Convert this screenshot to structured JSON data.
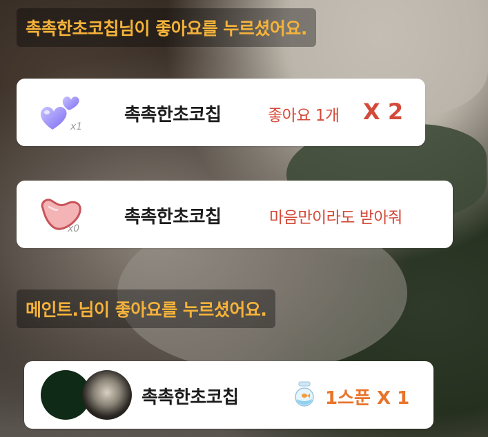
{
  "background": {
    "scene": "blurred live video feed"
  },
  "system_messages": [
    {
      "text": "촉촉한초코칩님이 좋아요를 누르셨어요."
    },
    {
      "text": "메인트.님이 좋아요를 누르셨어요."
    }
  ],
  "gift_cards": [
    {
      "icon": "purple-hearts-icon",
      "icon_count": "x1",
      "name": "촉촉한초코칩",
      "message": "좋아요 1개",
      "multiplier": "X 2"
    },
    {
      "icon": "pink-broken-heart-icon",
      "icon_count": "x0",
      "name": "촉촉한초코칩",
      "message": "마음만이라도 받아줘"
    }
  ],
  "spoon_card": {
    "name": "촉촉한초코칩",
    "icon": "fishbowl-icon",
    "spoon_text": "1스푼 X 1"
  },
  "colors": {
    "system_text": "#f6b33a",
    "message_red": "#d44a3a",
    "spoon_orange": "#e8742c"
  }
}
